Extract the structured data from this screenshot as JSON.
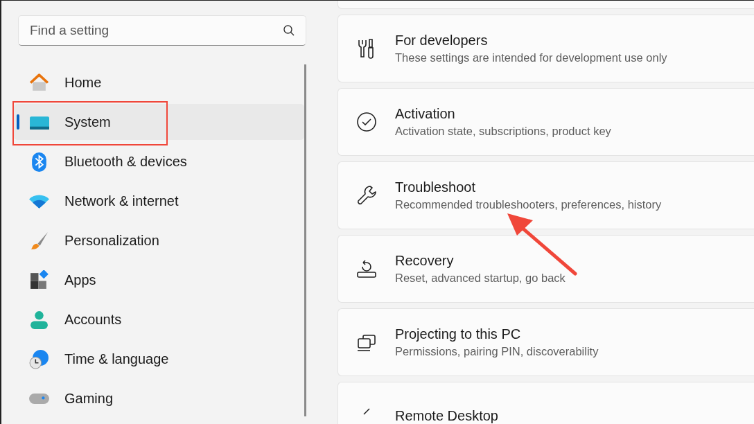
{
  "search": {
    "placeholder": "Find a setting"
  },
  "sidebar": {
    "items": [
      {
        "label": "Home",
        "selected": false
      },
      {
        "label": "System",
        "selected": true
      },
      {
        "label": "Bluetooth & devices",
        "selected": false
      },
      {
        "label": "Network & internet",
        "selected": false
      },
      {
        "label": "Personalization",
        "selected": false
      },
      {
        "label": "Apps",
        "selected": false
      },
      {
        "label": "Accounts",
        "selected": false
      },
      {
        "label": "Time & language",
        "selected": false
      },
      {
        "label": "Gaming",
        "selected": false
      }
    ]
  },
  "settings": [
    {
      "title": "For developers",
      "description": "These settings are intended for development use only"
    },
    {
      "title": "Activation",
      "description": "Activation state, subscriptions, product key"
    },
    {
      "title": "Troubleshoot",
      "description": "Recommended troubleshooters, preferences, history"
    },
    {
      "title": "Recovery",
      "description": "Reset, advanced startup, go back"
    },
    {
      "title": "Projecting to this PC",
      "description": "Permissions, pairing PIN, discoverability"
    },
    {
      "title": "Remote Desktop"
    }
  ]
}
